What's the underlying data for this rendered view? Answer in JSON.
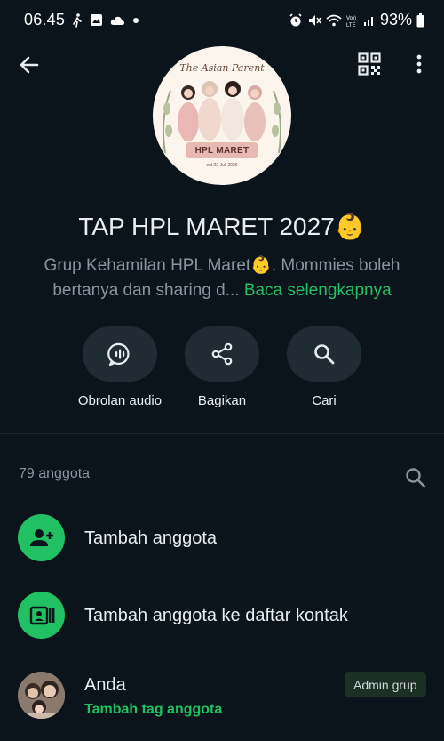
{
  "status_bar": {
    "time": "06.45",
    "battery_percent": "93%",
    "left_icons": [
      "walking-icon",
      "image-icon",
      "cloud-icon",
      "dot-icon"
    ],
    "right_icons": [
      "alarm-icon",
      "mute-icon",
      "wifi-icon",
      "volte-icon",
      "signal-icon",
      "battery-icon"
    ]
  },
  "toolbar": {
    "back_icon": "back-arrow-icon",
    "qr_icon": "qr-code-icon",
    "menu_icon": "more-vert-icon"
  },
  "group": {
    "avatar_title": "The Asian Parent",
    "avatar_banner": "HPL MARET",
    "avatar_date": "est 22 Juli 2026",
    "name": "TAP HPL MARET 2027👶",
    "description": "Grup Kehamilan HPL Maret👶. Mommies boleh bertanya  dan sharing d...",
    "read_more": "Baca selengkapnya"
  },
  "actions": [
    {
      "label": "Obrolan audio",
      "icon": "audio-chat-icon"
    },
    {
      "label": "Bagikan",
      "icon": "share-icon"
    },
    {
      "label": "Cari",
      "icon": "search-icon"
    }
  ],
  "members": {
    "count_label": "79 anggota",
    "add_member": "Tambah anggota",
    "add_to_contacts": "Tambah anggota ke daftar kontak",
    "you": {
      "name": "Anda",
      "tag_action": "Tambah tag anggota",
      "badge": "Admin grup"
    }
  },
  "colors": {
    "background": "#0b141a",
    "accent": "#21c063",
    "secondary_text": "#8696a0",
    "button_bg": "#1f2c34"
  }
}
